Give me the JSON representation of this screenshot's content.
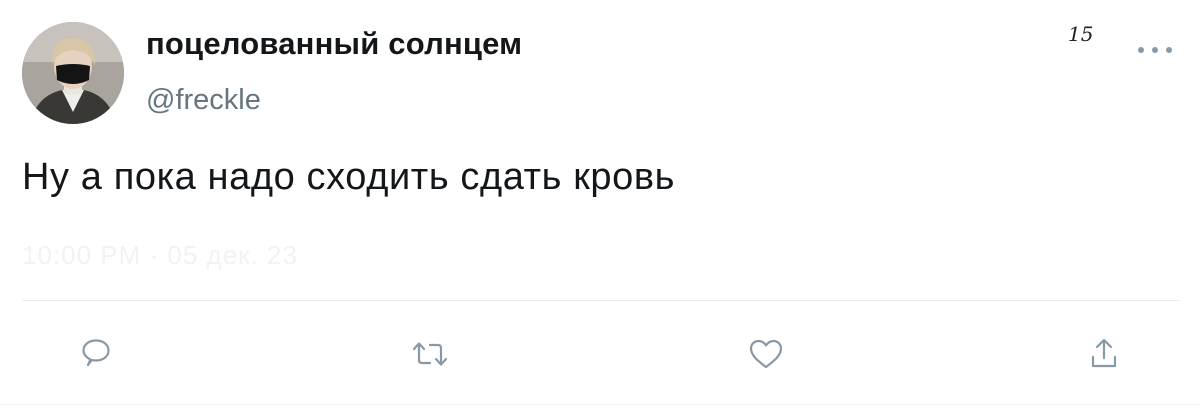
{
  "tweet": {
    "display_name": "поцелованный солнцем",
    "handle": "@freckle",
    "text": "Ну а пока надо сходить сдать кровь",
    "timestamp": "10:00 PM · 05 дек. 23",
    "scribble": "15",
    "actions": {
      "reply_icon": "reply-icon",
      "retweet_icon": "retweet-icon",
      "like_icon": "heart-icon",
      "share_icon": "share-icon"
    },
    "colors": {
      "name": "#14171a",
      "secondary": "#66757f",
      "icon": "#8899a6",
      "divider": "#e6ecf0"
    }
  }
}
